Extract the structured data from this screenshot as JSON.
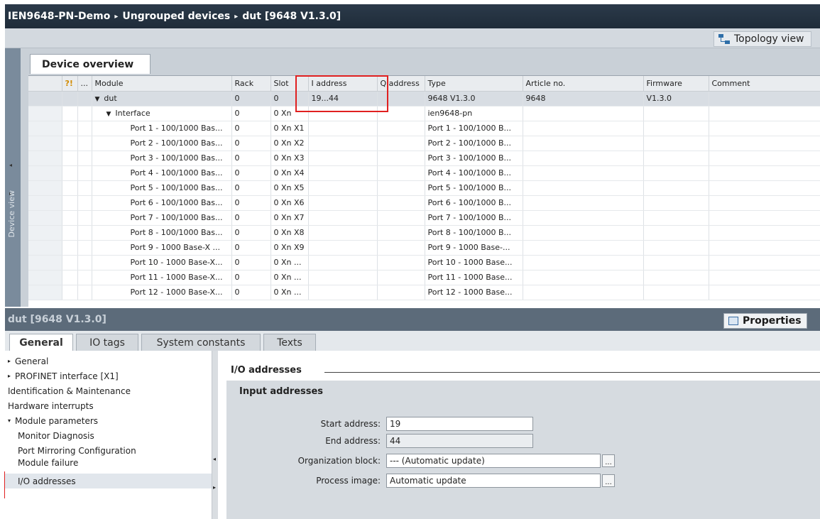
{
  "title": {
    "crumbs": [
      "IEN9648-PN-Demo",
      "Ungrouped devices",
      "dut [9648 V1.3.0]"
    ],
    "separator": "▸"
  },
  "toolbar": {
    "topology_view": "Topology view"
  },
  "device_view_label": "Device view",
  "device_overview_tab": "Device overview",
  "table": {
    "headers": [
      "",
      "...",
      "Module",
      "Rack",
      "Slot",
      "I address",
      "Q address",
      "Type",
      "Article no.",
      "Firmware",
      "Comment"
    ],
    "rows": [
      {
        "module": "dut",
        "rack": "0",
        "slot": "0",
        "i_address": "19...44",
        "q_address": "",
        "type": "9648 V1.3.0",
        "article": "9648",
        "firmware": "V1.3.0",
        "comment": ""
      },
      {
        "module": "Interface",
        "rack": "0",
        "slot": "0 Xn",
        "i_address": "",
        "q_address": "",
        "type": "ien9648-pn",
        "article": "",
        "firmware": "",
        "comment": ""
      },
      {
        "module": "Port 1 - 100/1000 Bas...",
        "rack": "0",
        "slot": "0 Xn X1",
        "i_address": "",
        "q_address": "",
        "type": "Port 1 - 100/1000 B...",
        "article": "",
        "firmware": "",
        "comment": ""
      },
      {
        "module": "Port 2 - 100/1000 Bas...",
        "rack": "0",
        "slot": "0 Xn X2",
        "i_address": "",
        "q_address": "",
        "type": "Port 2 - 100/1000 B...",
        "article": "",
        "firmware": "",
        "comment": ""
      },
      {
        "module": "Port 3 - 100/1000 Bas...",
        "rack": "0",
        "slot": "0 Xn X3",
        "i_address": "",
        "q_address": "",
        "type": "Port 3 - 100/1000 B...",
        "article": "",
        "firmware": "",
        "comment": ""
      },
      {
        "module": "Port 4 - 100/1000 Bas...",
        "rack": "0",
        "slot": "0 Xn X4",
        "i_address": "",
        "q_address": "",
        "type": "Port 4 - 100/1000 B...",
        "article": "",
        "firmware": "",
        "comment": ""
      },
      {
        "module": "Port 5 - 100/1000 Bas...",
        "rack": "0",
        "slot": "0 Xn X5",
        "i_address": "",
        "q_address": "",
        "type": "Port 5 - 100/1000 B...",
        "article": "",
        "firmware": "",
        "comment": ""
      },
      {
        "module": "Port 6 - 100/1000 Bas...",
        "rack": "0",
        "slot": "0 Xn X6",
        "i_address": "",
        "q_address": "",
        "type": "Port 6 - 100/1000 B...",
        "article": "",
        "firmware": "",
        "comment": ""
      },
      {
        "module": "Port 7 - 100/1000 Bas...",
        "rack": "0",
        "slot": "0 Xn X7",
        "i_address": "",
        "q_address": "",
        "type": "Port 7 - 100/1000 B...",
        "article": "",
        "firmware": "",
        "comment": ""
      },
      {
        "module": "Port 8 - 100/1000 Bas...",
        "rack": "0",
        "slot": "0 Xn X8",
        "i_address": "",
        "q_address": "",
        "type": "Port 8 - 100/1000 B...",
        "article": "",
        "firmware": "",
        "comment": ""
      },
      {
        "module": "Port 9 - 1000 Base-X ...",
        "rack": "0",
        "slot": "0 Xn X9",
        "i_address": "",
        "q_address": "",
        "type": "Port 9 - 1000 Base-...",
        "article": "",
        "firmware": "",
        "comment": ""
      },
      {
        "module": "Port 10 - 1000 Base-X...",
        "rack": "0",
        "slot": "0 Xn ...",
        "i_address": "",
        "q_address": "",
        "type": "Port 10 - 1000 Base...",
        "article": "",
        "firmware": "",
        "comment": ""
      },
      {
        "module": "Port 11 - 1000 Base-X...",
        "rack": "0",
        "slot": "0 Xn ...",
        "i_address": "",
        "q_address": "",
        "type": "Port 11 - 1000 Base...",
        "article": "",
        "firmware": "",
        "comment": ""
      },
      {
        "module": "Port 12 - 1000 Base-X...",
        "rack": "0",
        "slot": "0 Xn ...",
        "i_address": "",
        "q_address": "",
        "type": "Port 12 - 1000 Base...",
        "article": "",
        "firmware": "",
        "comment": ""
      }
    ]
  },
  "inspector": {
    "title": "dut [9648 V1.3.0]",
    "properties_label": "Properties",
    "tabs": [
      "General",
      "IO tags",
      "System constants",
      "Texts"
    ],
    "active_tab": "General"
  },
  "nav": {
    "items": [
      {
        "label": "General",
        "level": 0,
        "arrow": "▸"
      },
      {
        "label": "PROFINET interface [X1]",
        "level": 0,
        "arrow": "▸"
      },
      {
        "label": "Identification & Maintenance",
        "level": 0,
        "arrow": ""
      },
      {
        "label": "Hardware interrupts",
        "level": 0,
        "arrow": ""
      },
      {
        "label": "Module parameters",
        "level": 0,
        "arrow": "▾"
      },
      {
        "label": "Monitor Diagnosis",
        "level": 1,
        "arrow": ""
      },
      {
        "label": "Port Mirroring Configuration",
        "level": 1,
        "arrow": ""
      },
      {
        "label": "Module failure",
        "level": 1,
        "arrow": ""
      },
      {
        "label": "I/O addresses",
        "level": 0,
        "arrow": "",
        "selected": true
      }
    ]
  },
  "io": {
    "section_title": "I/O addresses",
    "input_title": "Input addresses",
    "start_label": "Start address:",
    "start_value": "19",
    "end_label": "End address:",
    "end_value": "44",
    "ob_label": "Organization block:",
    "ob_value": "--- (Automatic update)",
    "pi_label": "Process image:",
    "pi_value": "Automatic update"
  },
  "colors": {
    "highlight": "#e02020",
    "titlebar": "#2b3a4a"
  }
}
